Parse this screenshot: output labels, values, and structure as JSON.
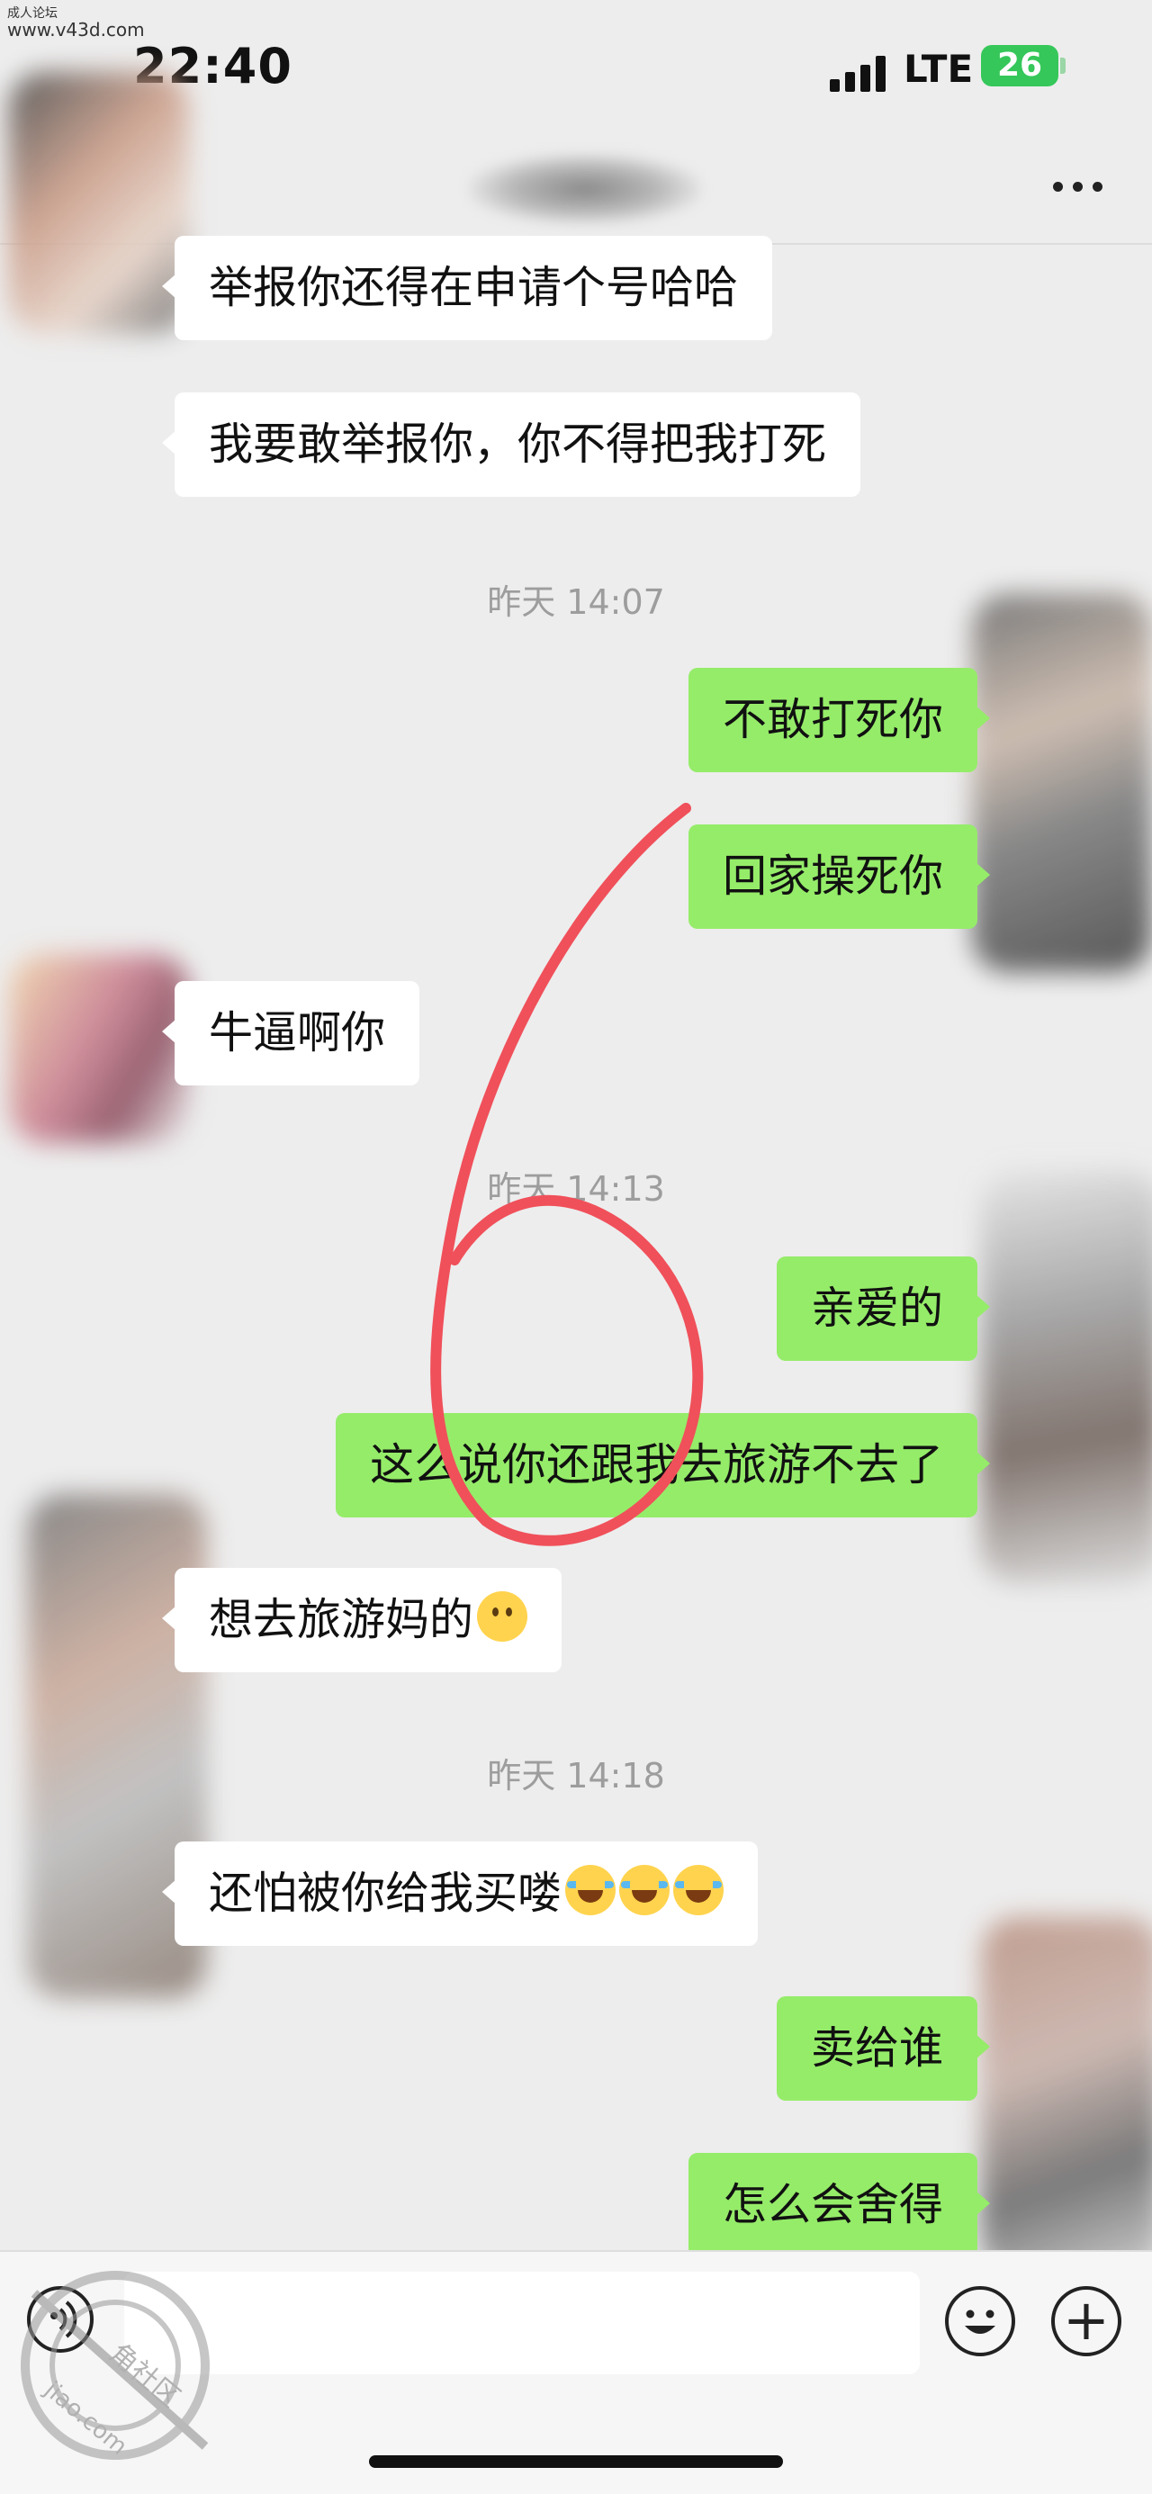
{
  "watermark": {
    "top_label": "成人论坛",
    "top_site": "www.v43d.com",
    "stamp_site": "jiao.com",
    "stamp_name": "角社区"
  },
  "status_bar": {
    "time": "22:40",
    "network": "LTE",
    "battery": "26"
  },
  "messages": [
    {
      "side": "left",
      "text": "举报你还得在申请个号哈哈"
    },
    {
      "side": "left",
      "text": "我要敢举报你，你不得把我打死"
    },
    {
      "timestamp": "昨天 14:07"
    },
    {
      "side": "right",
      "text": "不敢打死你"
    },
    {
      "side": "right",
      "text": "回家操死你"
    },
    {
      "side": "left",
      "text": "牛逼啊你"
    },
    {
      "timestamp": "昨天 14:13"
    },
    {
      "side": "right",
      "text": "亲爱的"
    },
    {
      "side": "right",
      "text": "这么说你还跟我去旅游不去了"
    },
    {
      "side": "left",
      "text": "想去旅游妈的",
      "emoji": [
        "smile-emoji"
      ]
    },
    {
      "timestamp": "昨天 14:18"
    },
    {
      "side": "left",
      "text": "还怕被你给我买喽",
      "emoji": [
        "laugh-cry-emoji",
        "laugh-cry-emoji",
        "laugh-cry-emoji"
      ]
    },
    {
      "side": "right",
      "text": "卖给谁"
    },
    {
      "side": "right",
      "text": "怎么会舍得"
    }
  ],
  "annotation": {
    "label": "6",
    "color": "#f0505a"
  },
  "input_bar": {
    "placeholder": ""
  },
  "icons": {
    "more": "more-icon",
    "voice": "voice-icon",
    "emoji": "emoji-icon",
    "add": "plus-icon"
  },
  "colors": {
    "background": "#ededed",
    "bubble_self": "#95ec69",
    "bubble_other": "#ffffff",
    "battery": "#35c759"
  }
}
